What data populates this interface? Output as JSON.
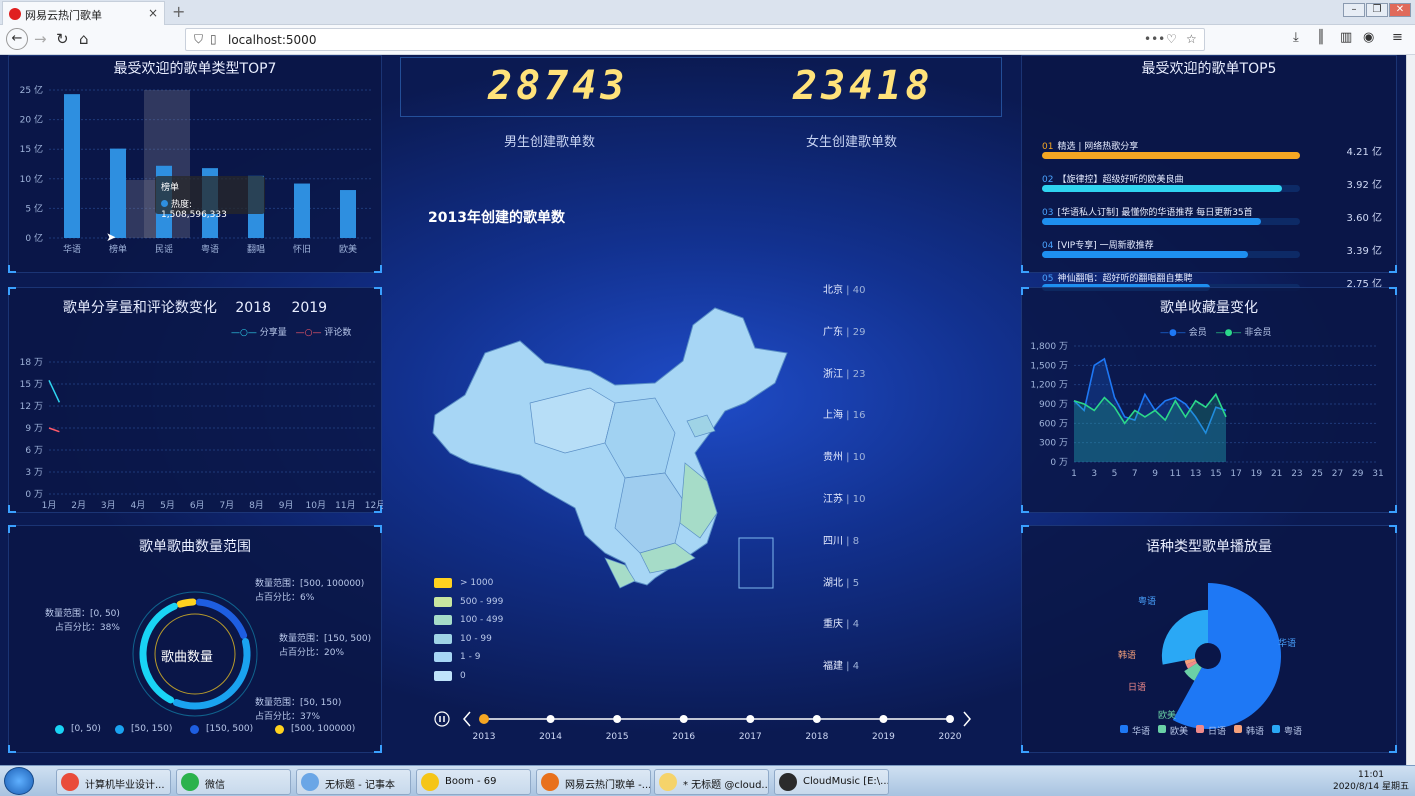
{
  "browser": {
    "tab_title": "网易云热门歌单",
    "tab_close": "×",
    "new_tab": "+",
    "url": "localhost:5000"
  },
  "colors": {
    "accent": "#3aa0ff",
    "bar": "#2e8fe0",
    "gold": "#ffe27a",
    "orange": "#f5a623"
  },
  "header": {
    "male_count": "28743",
    "female_count": "23418",
    "male_label": "男生创建歌单数",
    "female_label": "女生创建歌单数"
  },
  "map": {
    "title": "2013年创建的歌单数",
    "provinces": [
      {
        "name": "北京",
        "value": "40"
      },
      {
        "name": "广东",
        "value": "29"
      },
      {
        "name": "浙江",
        "value": "23"
      },
      {
        "name": "上海",
        "value": "16"
      },
      {
        "name": "贵州",
        "value": "10"
      },
      {
        "name": "江苏",
        "value": "10"
      },
      {
        "name": "四川",
        "value": "8"
      },
      {
        "name": "湖北",
        "value": "5"
      },
      {
        "name": "重庆",
        "value": "4"
      },
      {
        "name": "福建",
        "value": "4"
      }
    ],
    "legend": [
      {
        "label": "> 1000",
        "color": "#ffd21f"
      },
      {
        "label": "500 - 999",
        "color": "#c8e6a0"
      },
      {
        "label": "100 - 499",
        "color": "#a6dcc8"
      },
      {
        "label": "10 - 99",
        "color": "#9fd3e6"
      },
      {
        "label": "1 - 9",
        "color": "#a7d6f5"
      },
      {
        "label": "0",
        "color": "#bfe3fb"
      }
    ],
    "timeline": [
      "2013",
      "2014",
      "2015",
      "2016",
      "2017",
      "2018",
      "2019",
      "2020"
    ]
  },
  "panel_types": {
    "title": "最受欢迎的歌单类型TOP7",
    "tooltip_title": "榜单",
    "tooltip_value": "热度: 1,508,596,333"
  },
  "panel_share": {
    "title": "歌单分享量和评论数变化",
    "year1": "2018",
    "year2": "2019",
    "legend_share": "分享量",
    "legend_comment": "评论数"
  },
  "panel_range": {
    "title": "歌单歌曲数量范围",
    "center": "歌曲数量",
    "labels": [
      {
        "range": "数量范围：[500, 100000)",
        "pct": "占百分比：6%"
      },
      {
        "range": "数量范围：[0, 50)",
        "pct": "占百分比：38%"
      },
      {
        "range": "数量范围：[150, 500)",
        "pct": "占百分比：20%"
      },
      {
        "range": "数量范围：[50, 150)",
        "pct": "占百分比：37%"
      }
    ],
    "legend": [
      {
        "label": "[0, 50)",
        "color": "#19d4f5"
      },
      {
        "label": "[50, 150)",
        "color": "#1aa3f0"
      },
      {
        "label": "[150, 500)",
        "color": "#1e5ee0"
      },
      {
        "label": "[500, 100000)",
        "color": "#ffd21f"
      }
    ]
  },
  "panel_top5": {
    "title": "最受欢迎的歌单TOP5",
    "items": [
      {
        "rank": "01",
        "name": "精选 | 网络热歌分享",
        "value": "4.21 亿",
        "pct": 1.0,
        "color": "#f5a623"
      },
      {
        "rank": "02",
        "name": "【旋律控】超级好听的欧美良曲",
        "value": "3.92 亿",
        "pct": 0.93,
        "color": "#2fd4f0"
      },
      {
        "rank": "03",
        "name": "[华语私人订制] 最懂你的华语推荐 每日更新35首",
        "value": "3.60 亿",
        "pct": 0.85,
        "color": "#1e8ff0"
      },
      {
        "rank": "04",
        "name": "[VIP专享] 一周新歌推荐",
        "value": "3.39 亿",
        "pct": 0.8,
        "color": "#1e8ff0"
      },
      {
        "rank": "05",
        "name": "神仙翻唱：超好听的翻唱翻自集聘",
        "value": "2.75 亿",
        "pct": 0.65,
        "color": "#1e8ff0"
      }
    ]
  },
  "panel_collect": {
    "title": "歌单收藏量变化",
    "legend_member": "会员",
    "legend_nonmember": "非会员"
  },
  "panel_lang": {
    "title": "语种类型歌单播放量",
    "legend": [
      {
        "label": "华语",
        "color": "#1e78f5"
      },
      {
        "label": "欧美",
        "color": "#6ad1a6"
      },
      {
        "label": "日语",
        "color": "#f08a8a"
      },
      {
        "label": "韩语",
        "color": "#f5a07a"
      },
      {
        "label": "粤语",
        "color": "#2aa8f5"
      }
    ],
    "labels": {
      "cn": "华语",
      "yue": "粤语",
      "kr": "韩语",
      "jp": "日语",
      "en": "欧美"
    }
  },
  "taskbar": {
    "items": [
      {
        "label": "计算机毕业设计...",
        "color": "#e94c3a"
      },
      {
        "label": "微信",
        "color": "#2bb24c"
      },
      {
        "label": "无标题 - 记事本",
        "color": "#6aa6e6"
      },
      {
        "label": "Boom - 69",
        "color": "#f5c518"
      },
      {
        "label": "网易云热门歌单 -...",
        "color": "#e8711c"
      },
      {
        "label": "* 无标题 @cloud...",
        "color": "#f5d36a"
      },
      {
        "label": "CloudMusic [E:\\...",
        "color": "#2b2b2b"
      }
    ],
    "time": "11:01",
    "date": "2020/8/14 星期五"
  },
  "chart_data": [
    {
      "type": "bar",
      "title": "最受欢迎的歌单类型TOP7",
      "categories": [
        "华语",
        "榜单",
        "民谣",
        "粤语",
        "翻唱",
        "怀旧",
        "欧美"
      ],
      "values": [
        24.3,
        15.1,
        12.2,
        11.8,
        10.5,
        9.2,
        8.1
      ],
      "ylim": [
        0,
        25
      ],
      "yticks": [
        "0 亿",
        "5 亿",
        "10 亿",
        "15 亿",
        "20 亿",
        "25 亿"
      ]
    },
    {
      "type": "line",
      "title": "歌单分享量和评论数变化",
      "x": [
        "1月",
        "2月",
        "3月",
        "4月",
        "5月",
        "6月",
        "7月",
        "8月",
        "9月",
        "10月",
        "11月",
        "12月"
      ],
      "ylim": [
        0,
        18
      ],
      "yticks": [
        "0 万",
        "3 万",
        "6 万",
        "9 万",
        "12 万",
        "15 万",
        "18 万"
      ],
      "series": [
        {
          "name": "分享量",
          "values": [
            15.5,
            12.5
          ],
          "color": "#2fd4f0"
        },
        {
          "name": "评论数",
          "values": [
            9.0,
            8.5
          ],
          "color": "#ff5a6a"
        }
      ]
    },
    {
      "type": "pie",
      "title": "歌单歌曲数量范围",
      "categories": [
        "[0, 50)",
        "[50, 150)",
        "[150, 500)",
        "[500, 100000)"
      ],
      "values": [
        38,
        37,
        20,
        6
      ]
    },
    {
      "type": "area",
      "title": "歌单收藏量变化",
      "x": [
        1,
        2,
        3,
        4,
        5,
        6,
        7,
        8,
        9,
        10,
        11,
        12,
        13,
        14,
        15,
        16,
        17,
        18,
        19,
        20,
        21,
        22,
        23,
        24,
        25,
        26,
        27,
        28,
        29,
        30,
        31
      ],
      "xticks": [
        "1",
        "3",
        "5",
        "7",
        "9",
        "11",
        "13",
        "15",
        "17",
        "19",
        "21",
        "23",
        "25",
        "27",
        "29",
        "31"
      ],
      "ylim": [
        0,
        1800
      ],
      "yticks": [
        "0 万",
        "300 万",
        "600 万",
        "900 万",
        "1,200 万",
        "1,500 万",
        "1,800 万"
      ],
      "series": [
        {
          "name": "会员",
          "values": [
            950,
            800,
            1500,
            1600,
            1000,
            700,
            650,
            1050,
            800,
            950,
            1000,
            900,
            700,
            450,
            850,
            800
          ],
          "color": "#1e78f5"
        },
        {
          "name": "非会员",
          "values": [
            950,
            900,
            800,
            1000,
            850,
            600,
            800,
            700,
            800,
            650,
            950,
            700,
            950,
            850,
            1050,
            700
          ],
          "color": "#2bd88a"
        }
      ]
    },
    {
      "type": "pie",
      "title": "语种类型歌单播放量",
      "categories": [
        "华语",
        "欧美",
        "日语",
        "韩语",
        "粤语"
      ],
      "values": [
        58,
        8,
        3,
        3,
        28
      ]
    }
  ]
}
